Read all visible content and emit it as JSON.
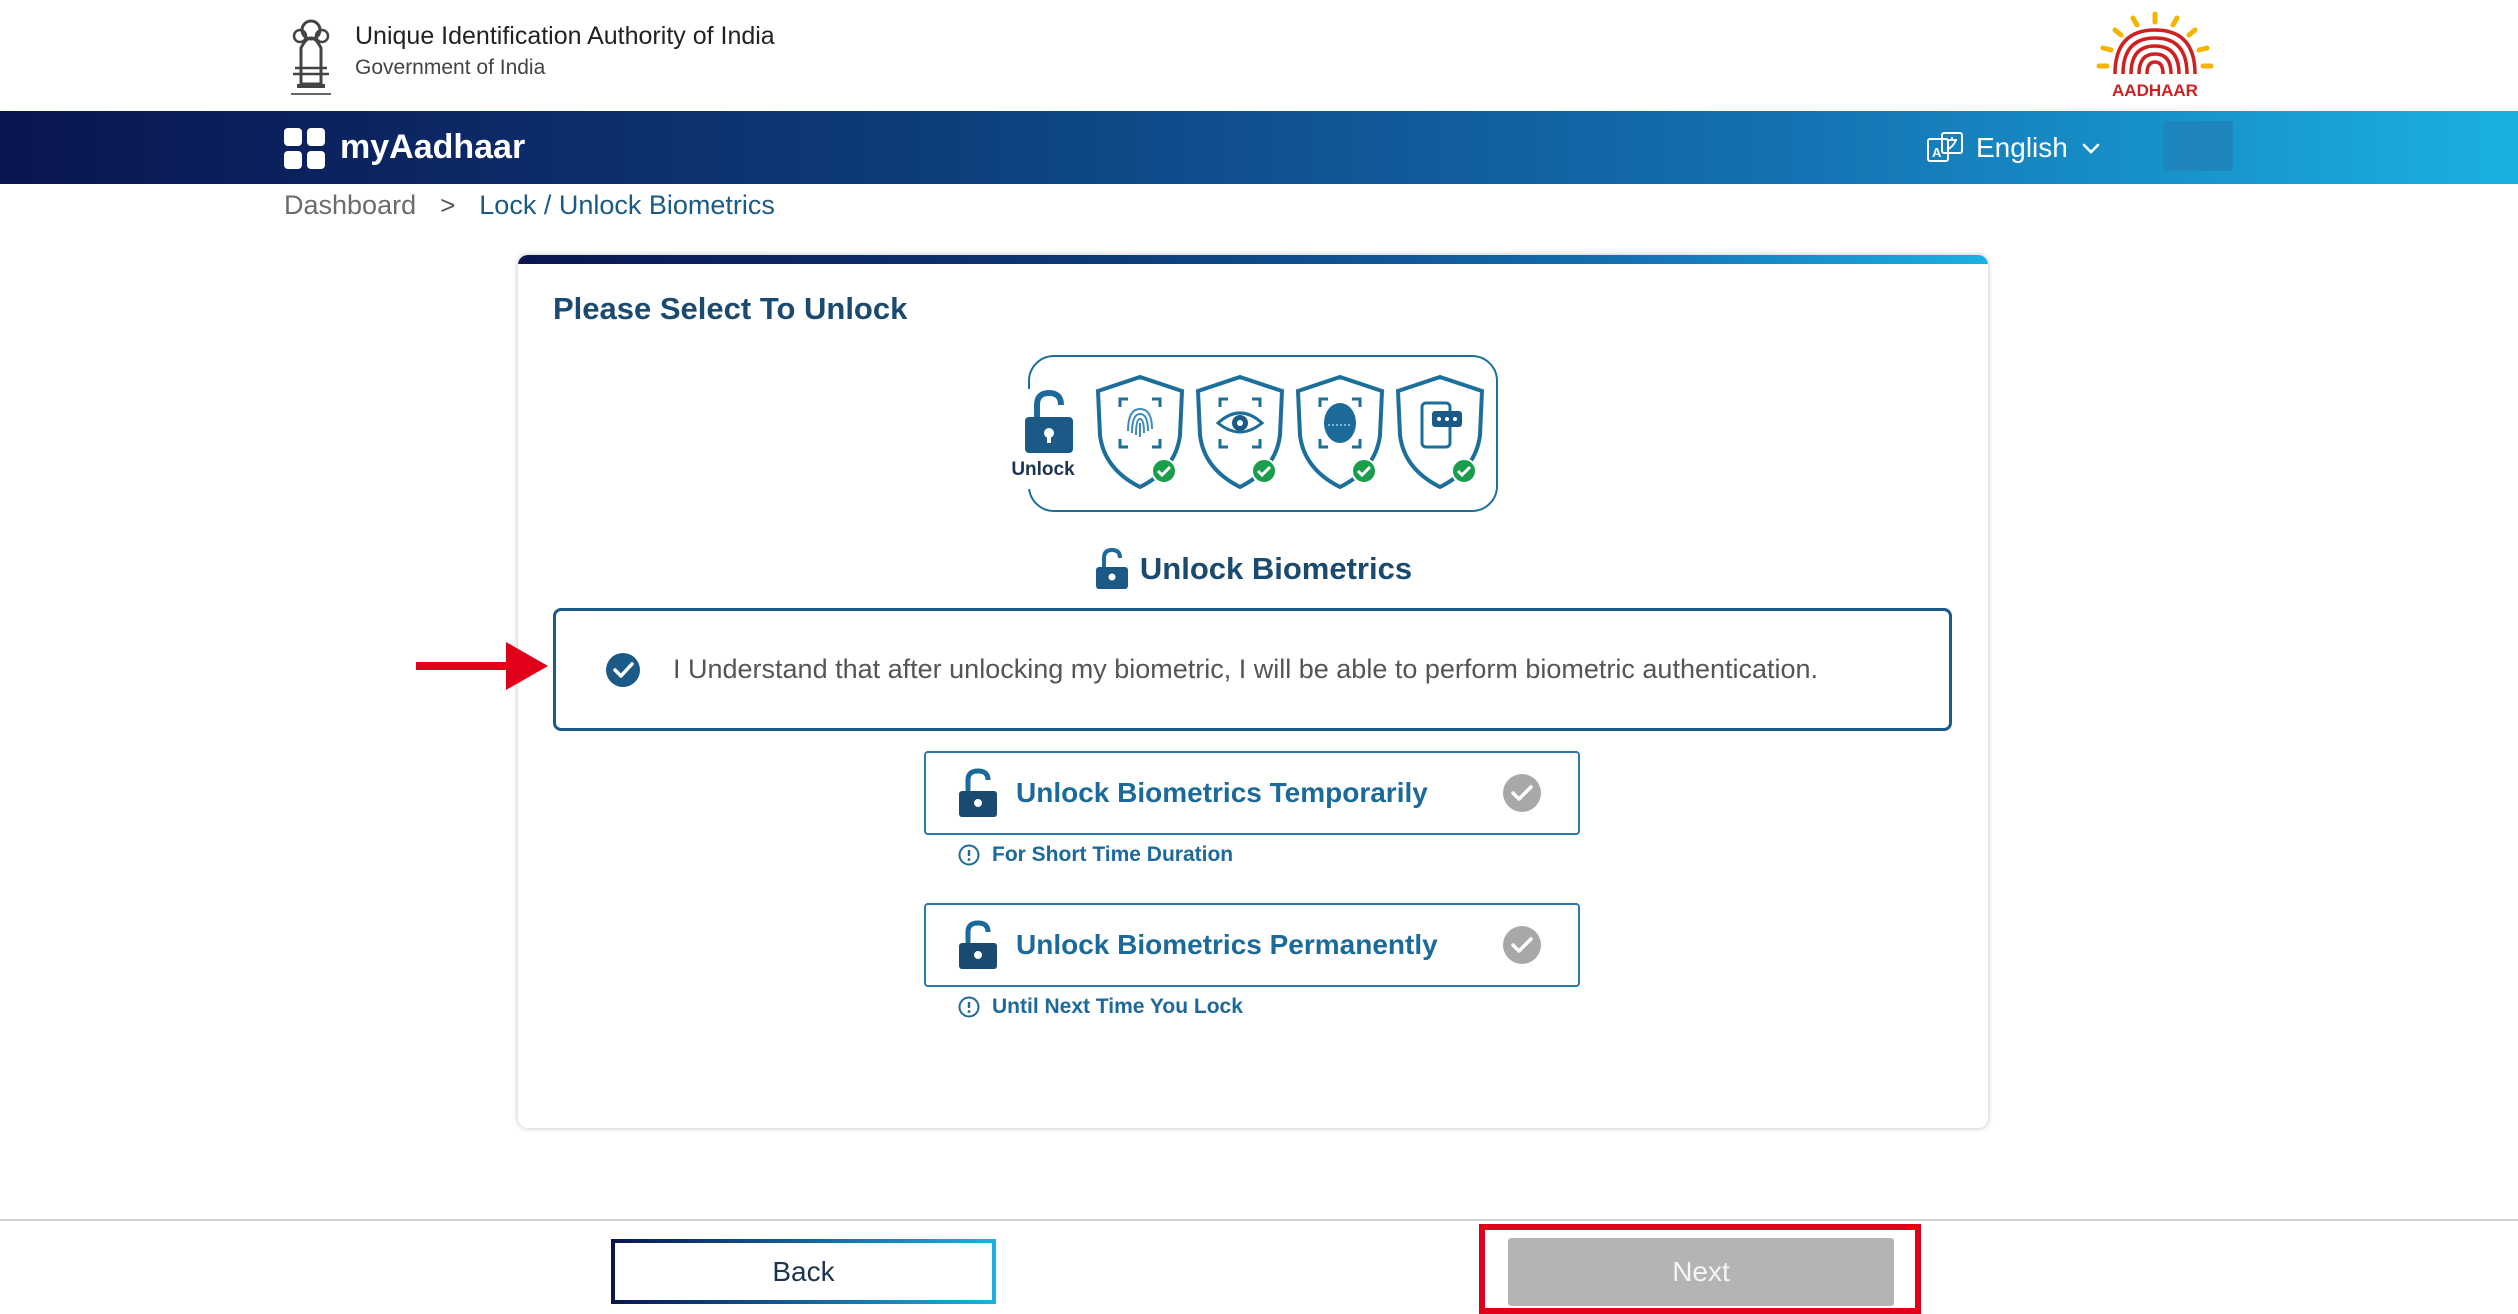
{
  "header": {
    "org_name": "Unique Identification Authority of India",
    "org_sub": "Government of India",
    "logo_text": "AADHAAR"
  },
  "navbar": {
    "brand": "myAadhaar",
    "language": "English"
  },
  "breadcrumb": {
    "home": "Dashboard",
    "separator": ">",
    "current": "Lock / Unlock Biometrics"
  },
  "card": {
    "title": "Please Select To Unlock",
    "hero_unlock_label": "Unlock",
    "hero_icons": [
      "fingerprint-icon",
      "iris-icon",
      "face-icon",
      "otp-device-icon"
    ],
    "section_heading": "Unlock Biometrics",
    "consent": {
      "checked": true,
      "text": "I Understand that after unlocking my biometric, I will be able to perform biometric authentication."
    },
    "options": [
      {
        "label": "Unlock Biometrics Temporarily",
        "hint": "For Short Time Duration",
        "selected": false
      },
      {
        "label": "Unlock Biometrics Permanently",
        "hint": "Until Next Time You Lock",
        "selected": false
      }
    ]
  },
  "footer": {
    "back_label": "Back",
    "next_label": "Next",
    "next_enabled": false
  },
  "colors": {
    "primary_dark": "#0a1550",
    "primary_light": "#1ab1df",
    "text_blue": "#1b6a9a",
    "success_green": "#1a9e4b",
    "annotation_red": "#e0001a",
    "disabled_gray": "#b5b3b4"
  }
}
